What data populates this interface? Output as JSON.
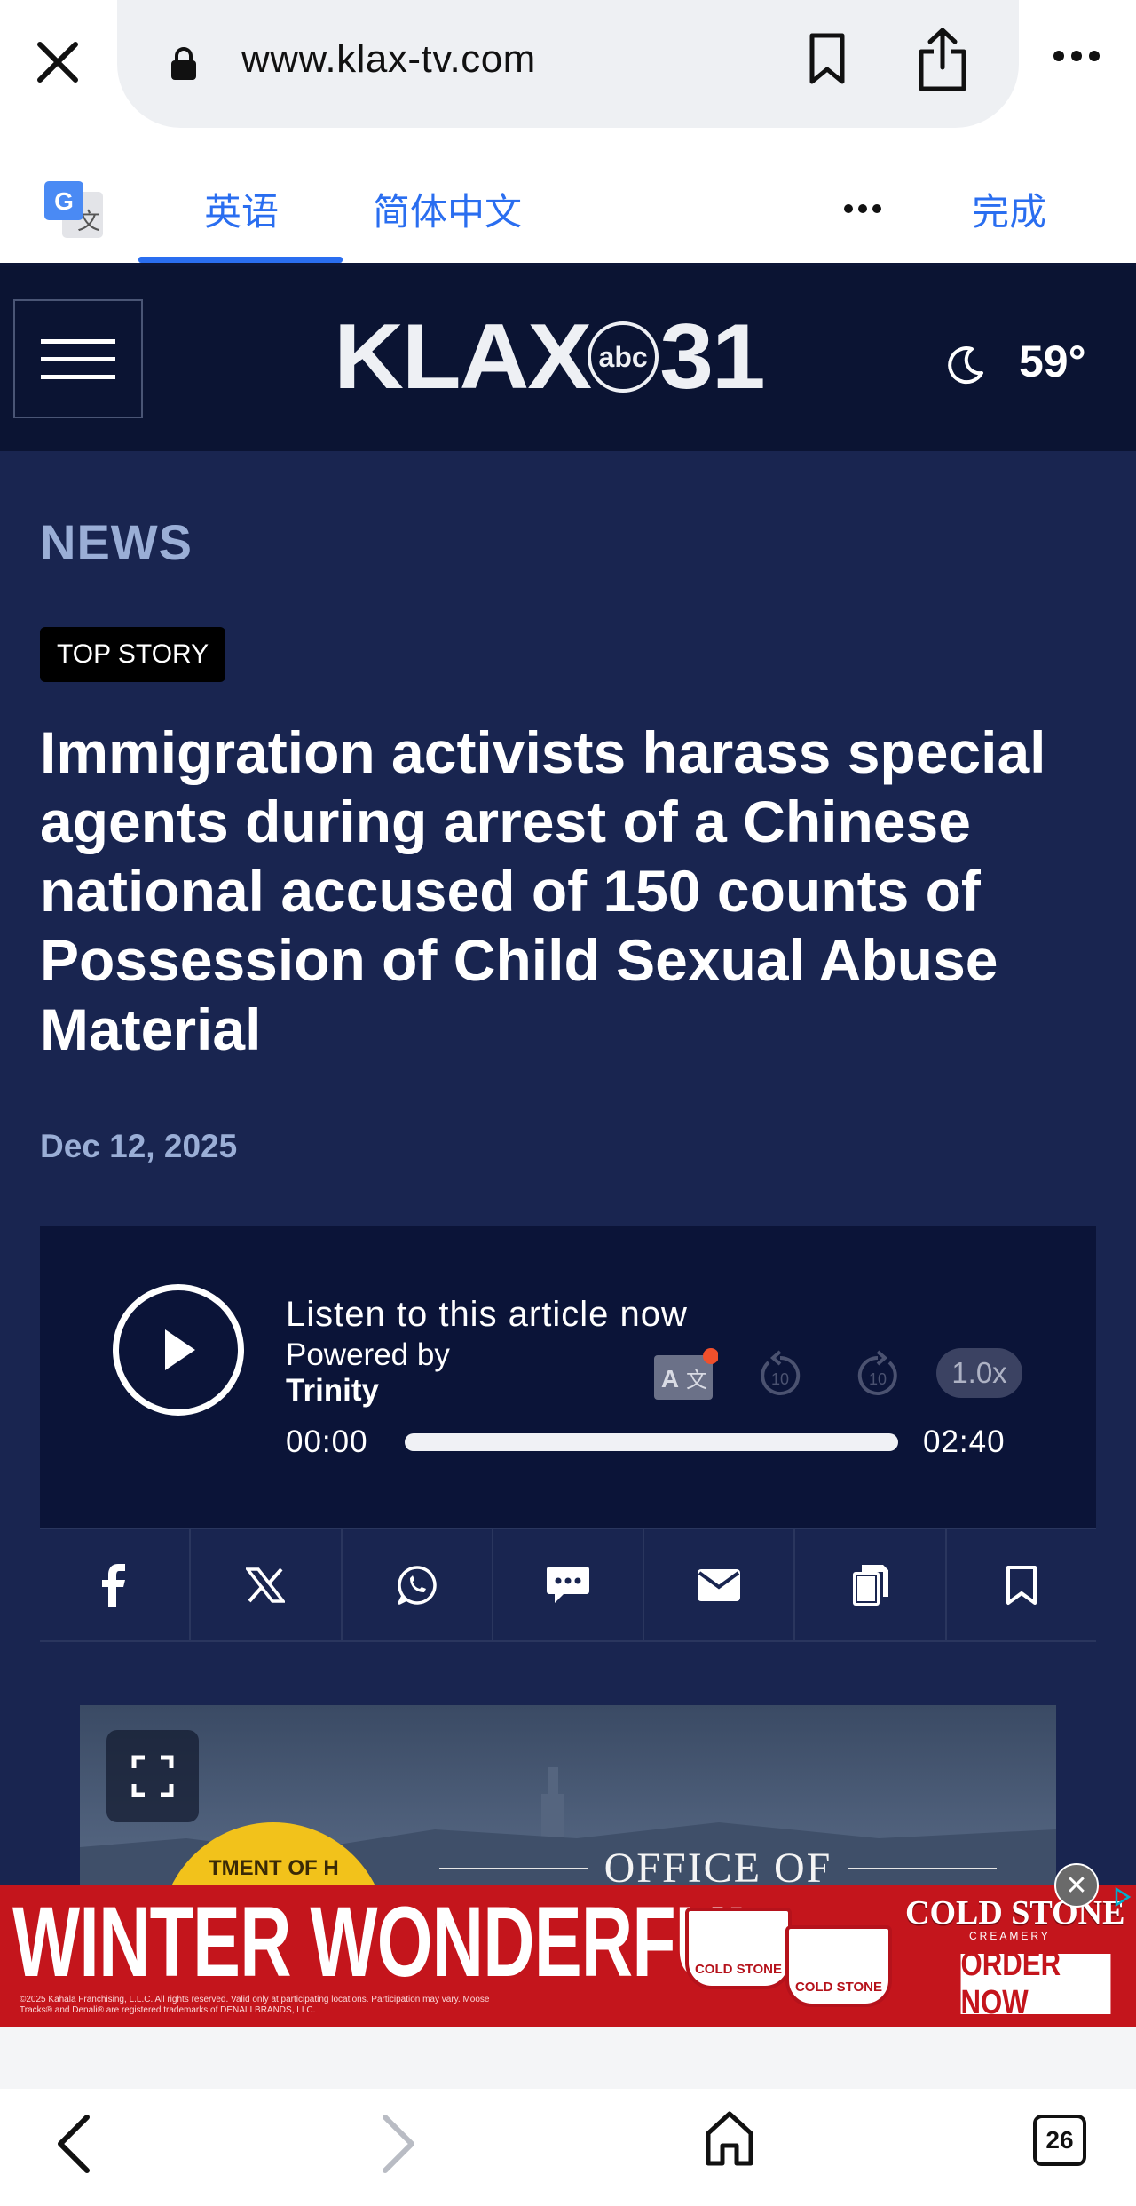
{
  "browser": {
    "url": "www.klax-tv.com",
    "tab_count": "26"
  },
  "translate_bar": {
    "source_lang": "英语",
    "target_lang": "简体中文",
    "more": "•••",
    "done": "完成"
  },
  "site": {
    "logo_text": "KLAX",
    "logo_network": "abc",
    "logo_channel": "31",
    "temperature": "59°"
  },
  "article": {
    "section": "NEWS",
    "badge": "TOP STORY",
    "headline": "Immigration activists harass special agents during arrest of a Chinese national accused of 150 counts of Possession of Child Sexual Abuse Material",
    "date": "Dec 12, 2025"
  },
  "player": {
    "title": "Listen to this article now",
    "powered_by": "Powered by",
    "provider": "Trinity",
    "current_time": "00:00",
    "duration": "02:40",
    "speed": "1.0x",
    "progress": 0
  },
  "share_icons": [
    "facebook-icon",
    "x-icon",
    "whatsapp-icon",
    "sms-icon",
    "email-icon",
    "copy-icon",
    "bookmark-icon"
  ],
  "media": {
    "caption_top": "OFFICE OF",
    "seal_text": "TMENT OF H"
  },
  "ad": {
    "headline": "WINTER WONDERFUL",
    "fine_print": "©2025 Kahala Franchising, L.L.C. All rights reserved. Valid only at participating locations. Participation may vary. Moose Tracks® and Denali® are registered trademarks of DENALI BRANDS, LLC.",
    "brand": "COLD STONE",
    "brand_sub": "CREAMERY",
    "cup_label": "COLD STONE",
    "cta": "ORDER NOW",
    "close": "✕"
  },
  "colors": {
    "header_bg": "#0b1433",
    "article_bg": "#192550",
    "player_bg": "#0b1438",
    "accent_blue": "#2a6ef0",
    "ad_red": "#c4151c"
  }
}
